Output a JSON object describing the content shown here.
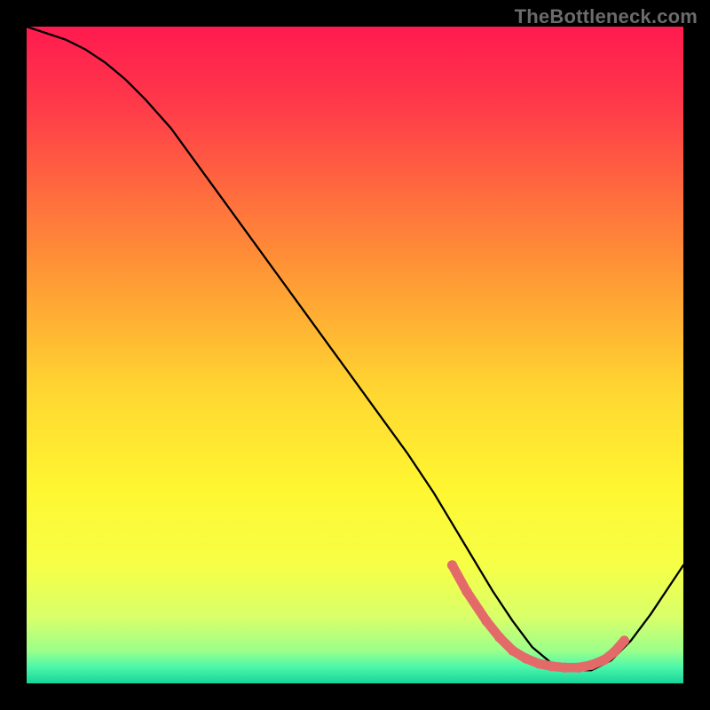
{
  "watermark": "TheBottleneck.com",
  "chart_data": {
    "type": "line",
    "title": "",
    "xlabel": "",
    "ylabel": "",
    "xlim": [
      0,
      100
    ],
    "ylim": [
      0,
      100
    ],
    "grid": false,
    "background_gradient": {
      "stops": [
        {
          "offset": 0.0,
          "color": "#ff1a4f"
        },
        {
          "offset": 0.12,
          "color": "#ff3a4a"
        },
        {
          "offset": 0.25,
          "color": "#ff6a3e"
        },
        {
          "offset": 0.4,
          "color": "#ffa034"
        },
        {
          "offset": 0.55,
          "color": "#ffd531"
        },
        {
          "offset": 0.7,
          "color": "#fff631"
        },
        {
          "offset": 0.82,
          "color": "#f6ff46"
        },
        {
          "offset": 0.9,
          "color": "#d8ff6a"
        },
        {
          "offset": 0.95,
          "color": "#9cff8a"
        },
        {
          "offset": 0.975,
          "color": "#4cf7a9"
        },
        {
          "offset": 1.0,
          "color": "#17d39a"
        }
      ]
    },
    "series": [
      {
        "name": "curve",
        "stroke": "#000000",
        "stroke_width": 2.3,
        "x": [
          0,
          3,
          6,
          9,
          12,
          15,
          18,
          22,
          26,
          30,
          34,
          38,
          42,
          46,
          50,
          54,
          58,
          62,
          65,
          68,
          71,
          74,
          77,
          80,
          83,
          86,
          89,
          92,
          95,
          98,
          100
        ],
        "y": [
          100,
          99,
          98,
          96.5,
          94.5,
          92,
          89,
          84.5,
          79,
          73.5,
          68,
          62.5,
          57,
          51.5,
          46,
          40.5,
          35,
          29,
          24,
          19,
          14,
          9.5,
          5.5,
          3,
          2,
          2,
          3.5,
          6.5,
          10.5,
          15,
          18
        ]
      },
      {
        "name": "highlight-dots",
        "stroke": "#e46a6a",
        "dot_radius": 5.6,
        "x": [
          64.8,
          67,
          70,
          72,
          74,
          76,
          78,
          80,
          82,
          84,
          86,
          88,
          89.5,
          91
        ],
        "y": [
          18,
          14,
          9.5,
          7,
          5,
          3.8,
          3,
          2.6,
          2.4,
          2.4,
          2.8,
          3.6,
          4.8,
          6.5
        ]
      }
    ]
  }
}
